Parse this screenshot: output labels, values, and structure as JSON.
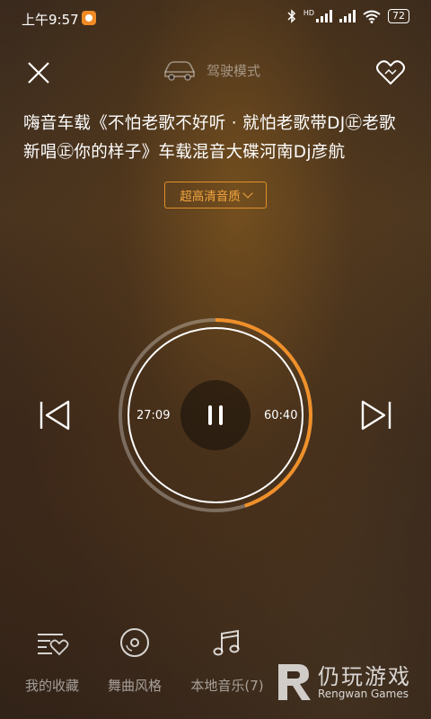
{
  "status_bar": {
    "time": "上午9:57",
    "network_label": "HD",
    "battery": "72"
  },
  "header": {
    "mode_label": "驾驶模式"
  },
  "song": {
    "title": "嗨音车载《不怕老歌不好听 · 就怕老歌带DJ㊣老歌新唱㊣你的样子》车载混音大碟河南Dj彦航"
  },
  "quality": {
    "label": "超高清音质"
  },
  "player": {
    "elapsed": "27:09",
    "total": "60:40",
    "progress": 0.45,
    "accent": "#f0902a"
  },
  "bottom_nav": [
    {
      "label": "我的收藏",
      "icon": "favorites-list-icon"
    },
    {
      "label": "舞曲风格",
      "icon": "disc-icon"
    },
    {
      "label": "本地音乐(7)",
      "icon": "music-note-icon"
    }
  ],
  "watermark": {
    "title": "仍玩游戏",
    "subtitle": "Rengwan Games"
  }
}
